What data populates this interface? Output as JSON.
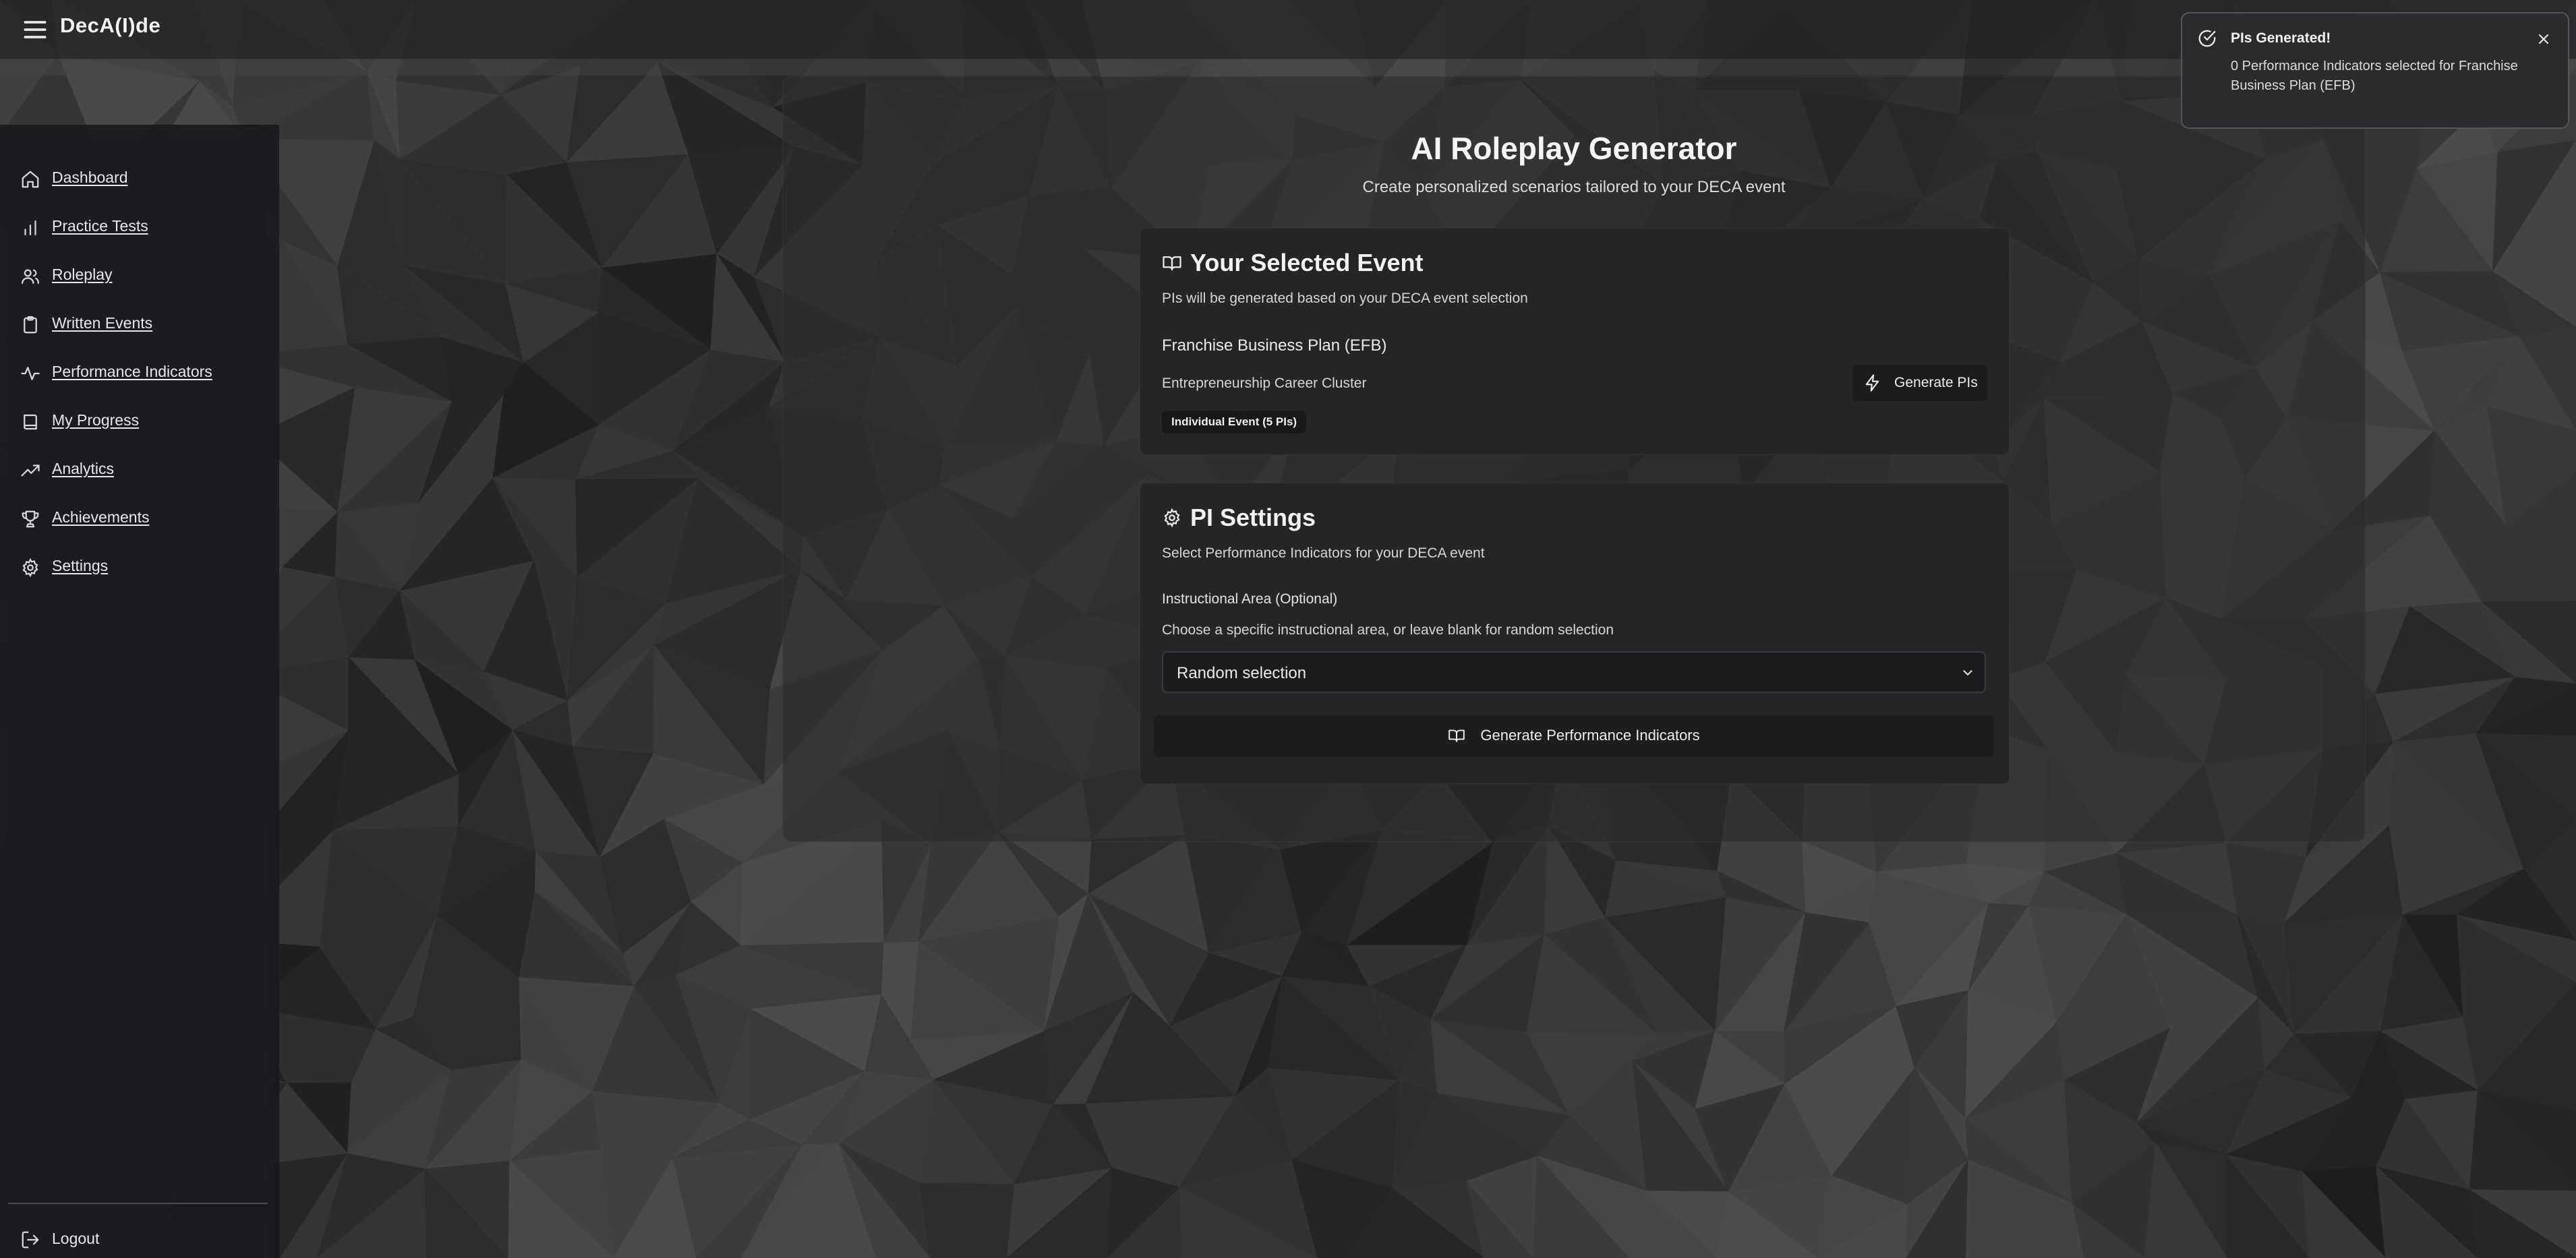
{
  "app": {
    "brand": "DecA(I)de"
  },
  "sidebar": {
    "items": [
      {
        "label": "Dashboard",
        "icon": "home-icon"
      },
      {
        "label": "Practice Tests",
        "icon": "bar-chart-icon"
      },
      {
        "label": "Roleplay",
        "icon": "users-icon"
      },
      {
        "label": "Written Events",
        "icon": "clipboard-icon"
      },
      {
        "label": "Performance Indicators",
        "icon": "activity-icon"
      },
      {
        "label": "My Progress",
        "icon": "book-icon"
      },
      {
        "label": "Analytics",
        "icon": "trending-up-icon"
      },
      {
        "label": "Achievements",
        "icon": "trophy-icon"
      },
      {
        "label": "Settings",
        "icon": "gear-icon"
      }
    ],
    "logout_label": "Logout"
  },
  "main": {
    "title": "AI Roleplay Generator",
    "subtitle": "Create personalized scenarios tailored to your DECA event",
    "event_card": {
      "heading": "Your Selected Event",
      "description": "PIs will be generated based on your DECA event selection",
      "event_name": "Franchise Business Plan (EFB)",
      "cluster": "Entrepreneurship Career Cluster",
      "badge": "Individual Event (5 PIs)",
      "generate_button": "Generate PIs"
    },
    "settings_card": {
      "heading": "PI Settings",
      "description": "Select Performance Indicators for your DECA event",
      "area_label": "Instructional Area (Optional)",
      "area_hint": "Choose a specific instructional area, or leave blank for random selection",
      "selected_option": "Random selection",
      "generate_button": "Generate Performance Indicators"
    }
  },
  "toast": {
    "title": "PIs Generated!",
    "message": "0 Performance Indicators selected for Franchise Business Plan (EFB)"
  },
  "colors": {
    "background": "#2a2a2c",
    "card": "#252527",
    "sidebar_panel": "#1b1c22",
    "text": "#e9e9ea"
  }
}
